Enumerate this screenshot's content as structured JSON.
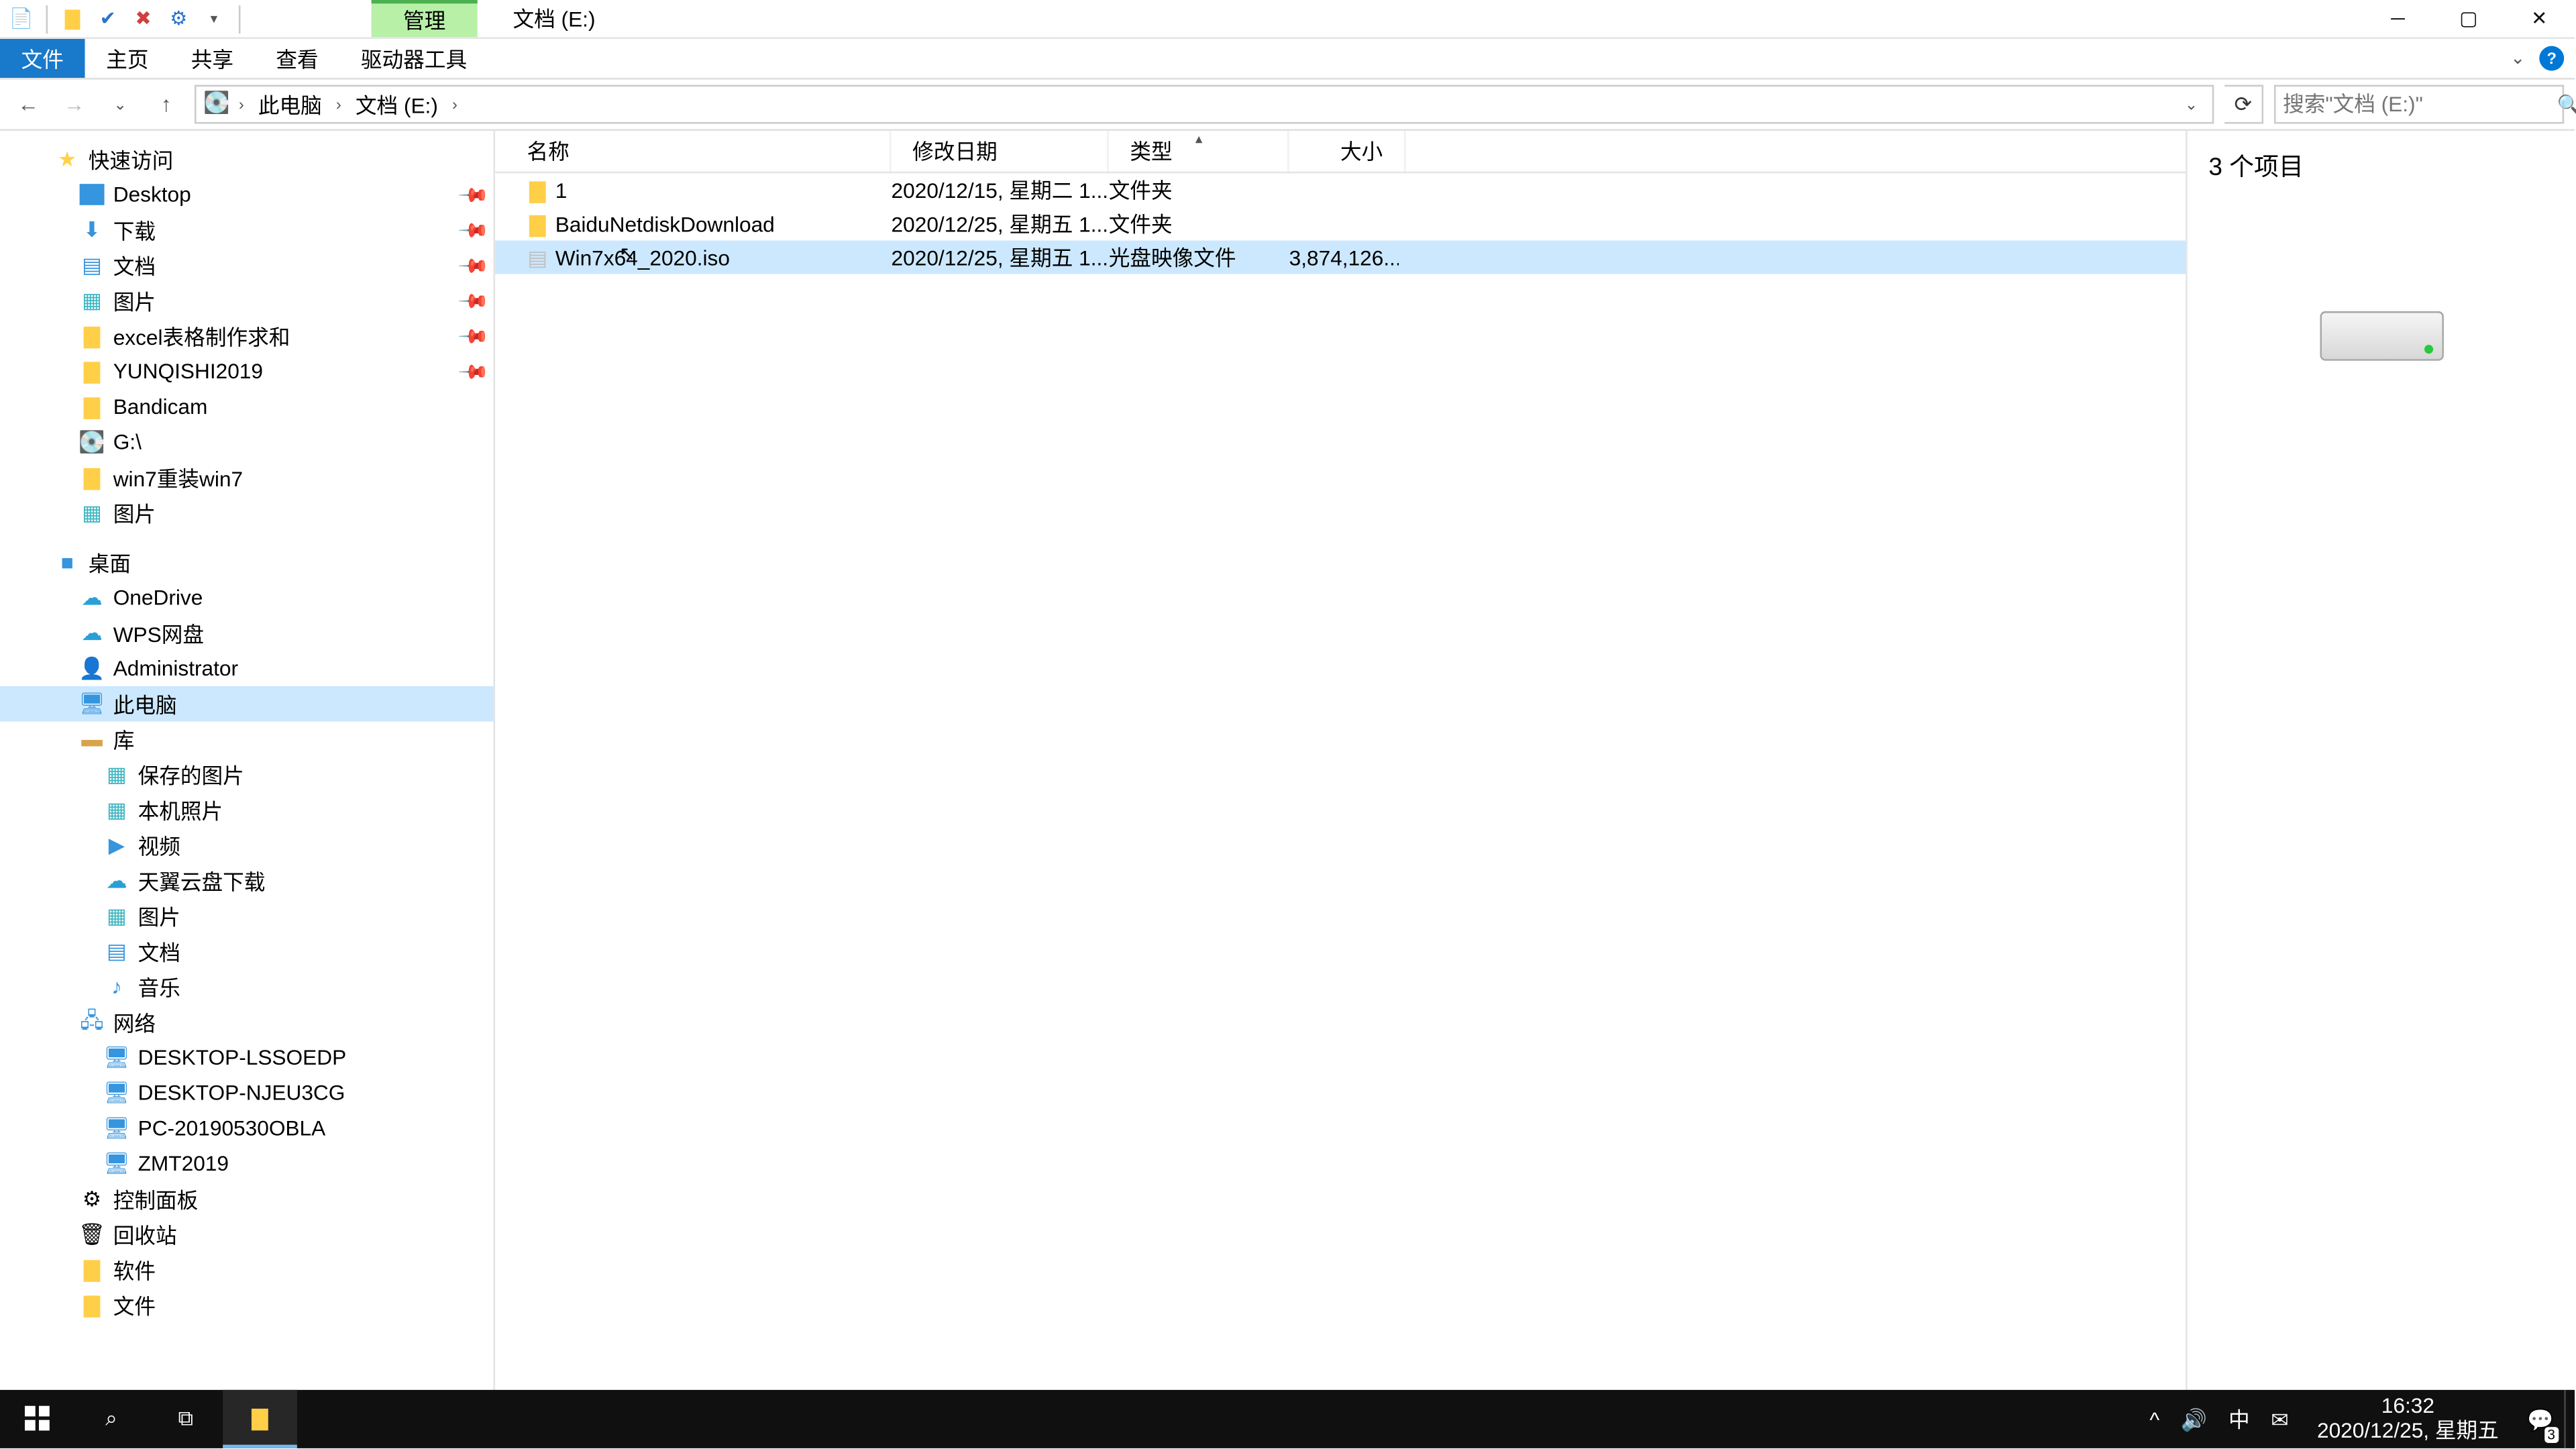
{
  "title": "文档 (E:)",
  "ribbon_context": "管理",
  "ribbon_tabs": {
    "file": "文件",
    "home": "主页",
    "share": "共享",
    "view": "查看",
    "drive": "驱动器工具"
  },
  "breadcrumb": [
    "此电脑",
    "文档 (E:)"
  ],
  "search_placeholder": "搜索\"文档 (E:)\"",
  "preview_title": "3 个项目",
  "status_text": "3 个项目",
  "columns": {
    "name": "名称",
    "date": "修改日期",
    "type": "类型",
    "size": "大小"
  },
  "files": [
    {
      "icon": "folder",
      "name": "1",
      "date": "2020/12/15, 星期二 1...",
      "type": "文件夹",
      "size": ""
    },
    {
      "icon": "folder",
      "name": "BaiduNetdiskDownload",
      "date": "2020/12/25, 星期五 1...",
      "type": "文件夹",
      "size": ""
    },
    {
      "icon": "iso",
      "name": "Win7x64_2020.iso",
      "date": "2020/12/25, 星期五 1...",
      "type": "光盘映像文件",
      "size": "3,874,126...",
      "selected": true,
      "cursor": true
    }
  ],
  "nav": [
    {
      "lvl": 1,
      "icon": "star",
      "label": "快速访问"
    },
    {
      "lvl": 2,
      "icon": "home",
      "label": "Desktop",
      "pin": true
    },
    {
      "lvl": 2,
      "icon": "dl",
      "label": "下载",
      "pin": true
    },
    {
      "lvl": 2,
      "icon": "doc",
      "label": "文档",
      "pin": true
    },
    {
      "lvl": 2,
      "icon": "pic",
      "label": "图片",
      "pin": true
    },
    {
      "lvl": 2,
      "icon": "folder",
      "label": "excel表格制作求和",
      "pin": true
    },
    {
      "lvl": 2,
      "icon": "folder",
      "label": "YUNQISHI2019",
      "pin": true
    },
    {
      "lvl": 2,
      "icon": "folder",
      "label": "Bandicam"
    },
    {
      "lvl": 2,
      "icon": "drv",
      "label": "G:\\"
    },
    {
      "lvl": 2,
      "icon": "folder",
      "label": "win7重装win7"
    },
    {
      "lvl": 2,
      "icon": "pic",
      "label": "图片"
    },
    {
      "lvl": 1,
      "icon": "desk",
      "label": "桌面",
      "gap": true
    },
    {
      "lvl": 2,
      "icon": "cloud",
      "label": "OneDrive"
    },
    {
      "lvl": 2,
      "icon": "cloud",
      "label": "WPS网盘"
    },
    {
      "lvl": 2,
      "icon": "user",
      "label": "Administrator"
    },
    {
      "lvl": 2,
      "icon": "pc",
      "label": "此电脑",
      "sel": true
    },
    {
      "lvl": 2,
      "icon": "lib",
      "label": "库"
    },
    {
      "lvl": 3,
      "icon": "pic",
      "label": "保存的图片"
    },
    {
      "lvl": 3,
      "icon": "pic",
      "label": "本机照片"
    },
    {
      "lvl": 3,
      "icon": "vid",
      "label": "视频"
    },
    {
      "lvl": 3,
      "icon": "cloud",
      "label": "天翼云盘下载"
    },
    {
      "lvl": 3,
      "icon": "pic",
      "label": "图片"
    },
    {
      "lvl": 3,
      "icon": "doc",
      "label": "文档"
    },
    {
      "lvl": 3,
      "icon": "aud",
      "label": "音乐"
    },
    {
      "lvl": 2,
      "icon": "net",
      "label": "网络"
    },
    {
      "lvl": 3,
      "icon": "npc",
      "label": "DESKTOP-LSSOEDP"
    },
    {
      "lvl": 3,
      "icon": "npc",
      "label": "DESKTOP-NJEU3CG"
    },
    {
      "lvl": 3,
      "icon": "npc",
      "label": "PC-20190530OBLA"
    },
    {
      "lvl": 3,
      "icon": "npc",
      "label": "ZMT2019"
    },
    {
      "lvl": 2,
      "icon": "ctrl",
      "label": "控制面板"
    },
    {
      "lvl": 2,
      "icon": "bin",
      "label": "回收站"
    },
    {
      "lvl": 2,
      "icon": "folder",
      "label": "软件"
    },
    {
      "lvl": 2,
      "icon": "folder",
      "label": "文件"
    }
  ],
  "taskbar": {
    "time": "16:32",
    "date": "2020/12/25, 星期五",
    "ime": "中",
    "badge": "3"
  }
}
